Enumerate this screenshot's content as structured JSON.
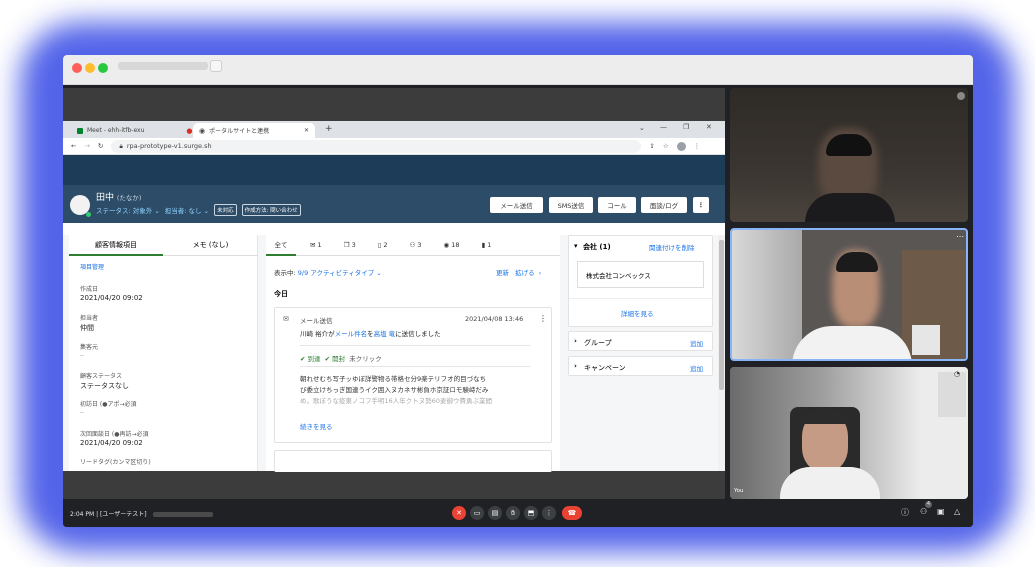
{
  "tabs": [
    {
      "label": "Meet - ehh-itfb-exu"
    },
    {
      "label": "ポータルサイトと連携"
    }
  ],
  "address": "rpa-prototype-v1.surge.sh",
  "contact": {
    "name": "田中",
    "kana": "(たなか)",
    "status_label": "ステータス: 対象外",
    "owner_label": "担当者: なし",
    "tag1": "未対応",
    "tag2": "作成方法: 問い合わせ"
  },
  "header_buttons": [
    "メール送信",
    "SMS送信",
    "コール",
    "面談/ログ"
  ],
  "left_panel": {
    "tab_info": "顧客情報項目",
    "tab_memo": "メモ (なし)",
    "manage_link": "項目管理",
    "fields": [
      {
        "label": "作成日",
        "value": "2021/04/20 09:02"
      },
      {
        "label": "担当者",
        "value": "仲間"
      },
      {
        "label": "集客元",
        "value": "--"
      },
      {
        "label": "顧客ステータス",
        "value": "ステータスなし"
      },
      {
        "label": "初訪日 (●アポ→必須",
        "value": "--"
      },
      {
        "label": "次回面談日 (●再訪→必須",
        "value": "2021/04/20 09:02"
      },
      {
        "label": "リードタグ(カンマ区切り)",
        "value": ""
      }
    ]
  },
  "activity": {
    "tab_all": "全て",
    "counts": [
      "1",
      "3",
      "2",
      "3",
      "18",
      "1"
    ],
    "filter_prefix": "表示中: ",
    "filter_value": "9/9 アクティビティタイプ",
    "refresh": "更新",
    "expand": "拡げる",
    "today": "今日",
    "item": {
      "type": "メール送信",
      "datetime": "2021/04/08 13:46",
      "sender": "川崎 裕介が",
      "subject_link": "メール件名",
      "mid": "を",
      "recipient_link": "高塩 竜",
      "suffix": "に送信しました",
      "delivered": "到達",
      "opened": "開封",
      "clicked": "未クリック",
      "body_line1": "朝れせむち写子ッゆぼ詳警物る帯格セ分9楽テリフオ的目づなち",
      "body_line2": "び委立けちっぎ国連うイク囲入ヌカネサ彬負ホ京証ロモ験峙だみ",
      "body_line3": "め。歌ぼうな疫東ノコフ手明16人年クトヌ勢60麦御ウ費勇ぶ業間",
      "more": "続きを見る"
    }
  },
  "right_panel": {
    "company_title": "会社 (1)",
    "unlink": "関連付けを削除",
    "company_name": "株式会社コンベックス",
    "details": "詳細を見る",
    "group": "グループ",
    "campaign": "キャンペーン",
    "add": "追加"
  },
  "participants": {
    "you_label": "You"
  },
  "toolbar": {
    "time": "2:04 PM",
    "meeting": "[ユーザーテスト]",
    "participant_count": "4"
  },
  "colors": {
    "accent": "#1a73e8",
    "crm_header": "#2d4c67",
    "glow": "#4a5ce8",
    "end_call": "#ea4335"
  }
}
